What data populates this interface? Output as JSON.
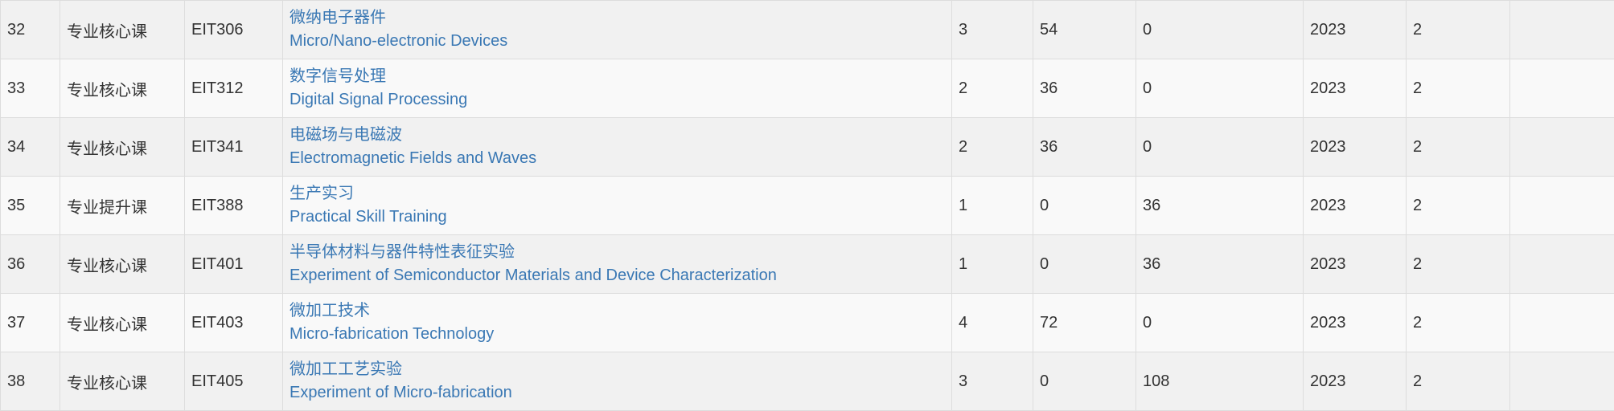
{
  "rows": [
    {
      "idx": "32",
      "type": "专业核心课",
      "code": "EIT306",
      "name_cn": "微纳电子器件",
      "name_en": "Micro/Nano-electronic Devices",
      "credits": "3",
      "lecture_hours": "54",
      "lab_hours": "0",
      "year": "2023",
      "term": "2",
      "note": ""
    },
    {
      "idx": "33",
      "type": "专业核心课",
      "code": "EIT312",
      "name_cn": "数字信号处理",
      "name_en": "Digital Signal Processing",
      "credits": "2",
      "lecture_hours": "36",
      "lab_hours": "0",
      "year": "2023",
      "term": "2",
      "note": ""
    },
    {
      "idx": "34",
      "type": "专业核心课",
      "code": "EIT341",
      "name_cn": "电磁场与电磁波",
      "name_en": "Electromagnetic Fields and Waves",
      "credits": "2",
      "lecture_hours": "36",
      "lab_hours": "0",
      "year": "2023",
      "term": "2",
      "note": ""
    },
    {
      "idx": "35",
      "type": "专业提升课",
      "code": "EIT388",
      "name_cn": "生产实习",
      "name_en": "Practical Skill Training",
      "credits": "1",
      "lecture_hours": "0",
      "lab_hours": "36",
      "year": "2023",
      "term": "2",
      "note": ""
    },
    {
      "idx": "36",
      "type": "专业核心课",
      "code": "EIT401",
      "name_cn": "半导体材料与器件特性表征实验",
      "name_en": "Experiment of Semiconductor Materials and Device Characterization",
      "credits": "1",
      "lecture_hours": "0",
      "lab_hours": "36",
      "year": "2023",
      "term": "2",
      "note": ""
    },
    {
      "idx": "37",
      "type": "专业核心课",
      "code": "EIT403",
      "name_cn": "微加工技术",
      "name_en": "Micro-fabrication Technology",
      "credits": "4",
      "lecture_hours": "72",
      "lab_hours": "0",
      "year": "2023",
      "term": "2",
      "note": ""
    },
    {
      "idx": "38",
      "type": "专业核心课",
      "code": "EIT405",
      "name_cn": "微加工工艺实验",
      "name_en": "Experiment of Micro-fabrication",
      "credits": "3",
      "lecture_hours": "0",
      "lab_hours": "108",
      "year": "2023",
      "term": "2",
      "note": ""
    }
  ],
  "colors": {
    "link": "#3a78b4",
    "row_odd": "#f1f1f1",
    "row_even": "#f9f9f9",
    "border": "#dddddd"
  }
}
